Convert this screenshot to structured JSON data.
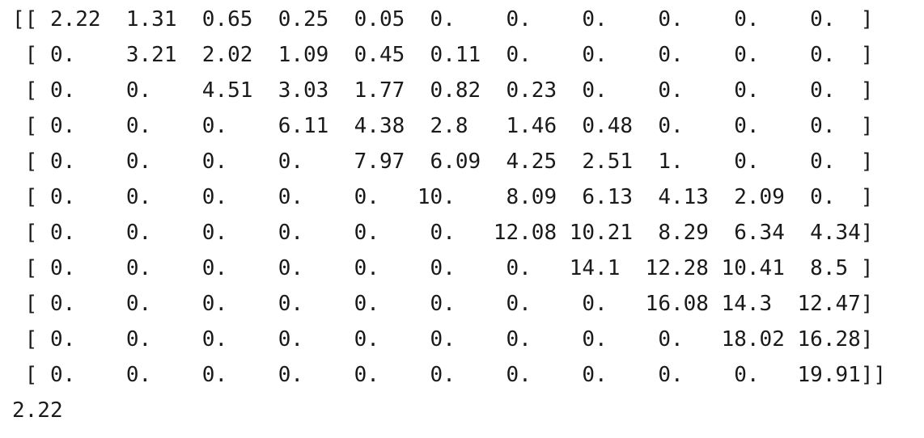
{
  "console": {
    "output_lines": [
      "[[ 2.22  1.31  0.65  0.25  0.05  0.    0.    0.    0.    0.    0.  ]",
      " [ 0.    3.21  2.02  1.09  0.45  0.11  0.    0.    0.    0.    0.  ]",
      " [ 0.    0.    4.51  3.03  1.77  0.82  0.23  0.    0.    0.    0.  ]",
      " [ 0.    0.    0.    6.11  4.38  2.8   1.46  0.48  0.    0.    0.  ]",
      " [ 0.    0.    0.    0.    7.97  6.09  4.25  2.51  1.    0.    0.  ]",
      " [ 0.    0.    0.    0.    0.   10.    8.09  6.13  4.13  2.09  0.  ]",
      " [ 0.    0.    0.    0.    0.    0.   12.08 10.21  8.29  6.34  4.34]",
      " [ 0.    0.    0.    0.    0.    0.    0.   14.1  12.28 10.41  8.5 ]",
      " [ 0.    0.    0.    0.    0.    0.    0.    0.   16.08 14.3  12.47]",
      " [ 0.    0.    0.    0.    0.    0.    0.    0.    0.   18.02 16.28]",
      " [ 0.    0.    0.    0.    0.    0.    0.    0.    0.    0.   19.91]]",
      "2.22"
    ]
  }
}
